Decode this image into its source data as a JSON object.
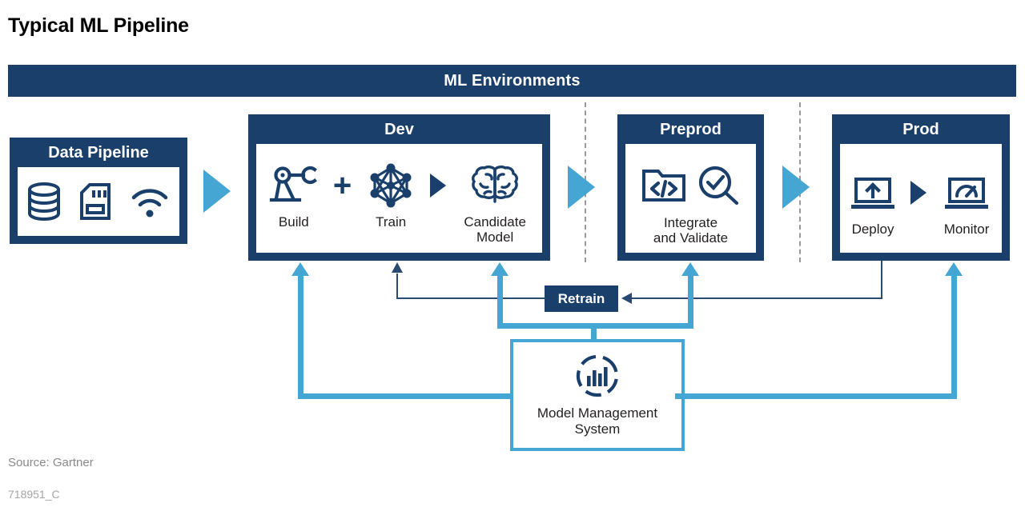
{
  "page_title": "Typical ML Pipeline",
  "env_bar": {
    "label": "ML Environments"
  },
  "data_pipeline": {
    "title": "Data Pipeline",
    "icons": [
      {
        "name": "database-icon",
        "label": "database"
      },
      {
        "name": "memory-card-icon",
        "label": "memory card"
      },
      {
        "name": "wifi-icon",
        "label": "wifi"
      }
    ]
  },
  "stages": {
    "dev": {
      "title": "Dev",
      "items": [
        {
          "icon": "robot-arm-icon",
          "caption": "Build"
        },
        {
          "icon": "neural-network-icon",
          "caption": "Train"
        },
        {
          "icon": "brain-icon",
          "caption": "Candidate\nModel"
        }
      ],
      "separator_symbol": "+"
    },
    "preprod": {
      "title": "Preprod",
      "items": [
        {
          "icon": "code-folder-icon",
          "caption": ""
        },
        {
          "icon": "magnifier-check-icon",
          "caption": ""
        }
      ],
      "caption": "Integrate\nand Validate"
    },
    "prod": {
      "title": "Prod",
      "items": [
        {
          "icon": "laptop-upload-icon",
          "caption": "Deploy"
        },
        {
          "icon": "laptop-gauge-icon",
          "caption": "Monitor"
        }
      ]
    }
  },
  "retrain": {
    "label": "Retrain"
  },
  "model_management": {
    "icon": "dashed-circle-bar-chart-icon",
    "caption": "Model Management\nSystem"
  },
  "footer": {
    "source": "Source: Gartner",
    "doc_id": "718951_C"
  },
  "colors": {
    "navy": "#1a3f6b",
    "light_blue": "#45a6d4",
    "text_dark": "#231f20",
    "footer_gray": "#8a8a8a",
    "dashed_gray": "#9a9a9a"
  }
}
